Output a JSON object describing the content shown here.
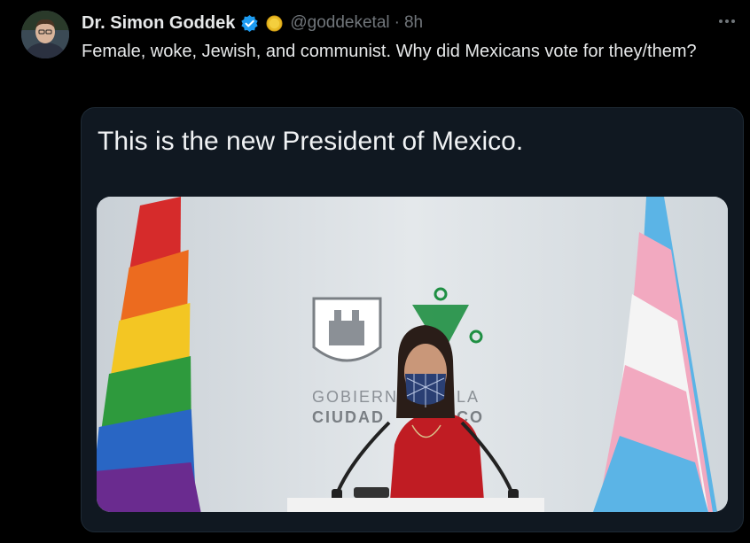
{
  "author": {
    "display_name": "Dr. Simon Goddek",
    "handle": "@goddeketal",
    "separator": "·",
    "timestamp": "8h"
  },
  "tweet": {
    "text": "Female, woke, Jewish, and communist. Why did Mexicans vote for they/them?"
  },
  "quoted": {
    "caption": "This is the new President of Mexico.",
    "sign_text_line1": "GOBIERN",
    "sign_text_line1b": "LA",
    "sign_text_line2": "CIUDAD",
    "sign_text_line2b": "CO"
  },
  "icons": {
    "verified": "verified-badge-icon",
    "affiliate": "gold-coin-icon",
    "more": "more-options-icon"
  },
  "colors": {
    "background": "#000000",
    "text_primary": "#e7e9ea",
    "text_secondary": "#71767b",
    "verified_blue": "#1d9bf0",
    "card_bg": "#101821"
  }
}
